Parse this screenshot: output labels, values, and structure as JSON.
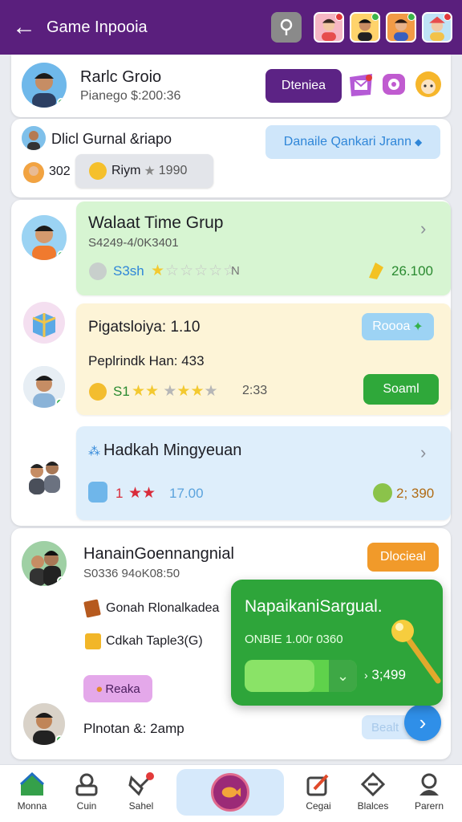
{
  "header": {
    "title": "Game Inpooia"
  },
  "card1": {
    "name": "Rarlc Groio",
    "subtitle": "Pianego $:200:36",
    "action_button": "Dteniea"
  },
  "card2": {
    "name": "Dlicl Gurnal &riapo",
    "pill": "Danaile Qankari Jrann",
    "count": "302",
    "badge": "Riym",
    "badge_value": "1990"
  },
  "tile1": {
    "title": "Walaat Time Grup",
    "subtitle": "S4249-4/0K3401",
    "stat_label": "S3sh",
    "stat_n": "N",
    "value": "26.100"
  },
  "tile2": {
    "title": "Pigatsloiya: 1.10",
    "line": "Peplrindk Han: 433",
    "stat": "S1",
    "value": "2:33",
    "tag": "Roooa",
    "button": "Soaml"
  },
  "tile3": {
    "title": "Hadkah Mingyeuan",
    "count": "1",
    "value_a": "17.00",
    "value_b": "2; 390"
  },
  "card3": {
    "name": "HanainGoennangnial",
    "subtitle": "S0336 94oK08:50",
    "button": "Dlocieal",
    "item1": "Gonah Rlonalkadea",
    "item2": "Cdkah Taple3(G)",
    "tag": "Reaka",
    "footer": "Plnotan &: 2amp",
    "footer_pill": "Bealt"
  },
  "popup": {
    "title": "NapaikaniSargual.",
    "subtitle": "ONBIE 1.00r 0360",
    "value": "3;499",
    "progress": 0.62
  },
  "nav": {
    "items": [
      "Monna",
      "Cuin",
      "Sahel",
      "Cegai",
      "Blalces",
      "Parern"
    ]
  },
  "colors": {
    "header": "#5a1f7d",
    "accent_purple": "#5c2385",
    "green": "#2ea53a",
    "blue": "#2f8fe8",
    "orange": "#f19a2a"
  }
}
